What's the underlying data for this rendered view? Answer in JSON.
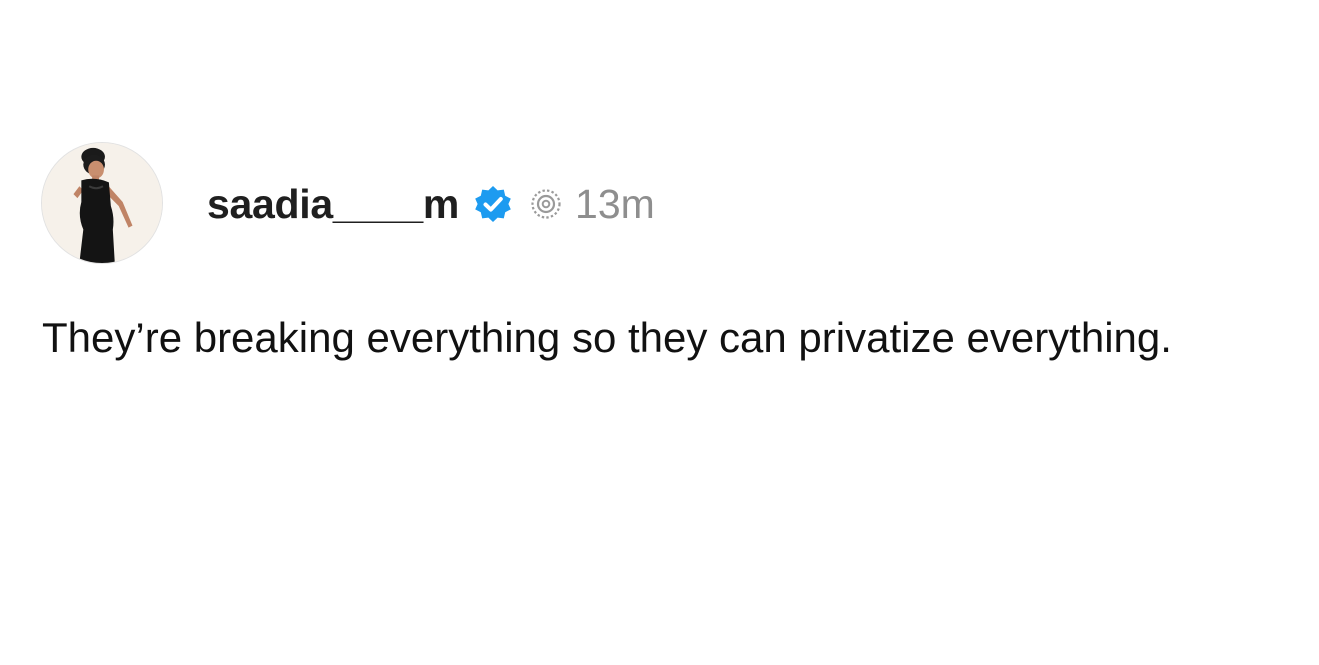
{
  "post": {
    "username": "saadia____m",
    "verified": true,
    "timestamp": "13m",
    "text": "They’re breaking everything so they can privatize everything."
  },
  "icons": {
    "verified": "verified-badge-icon",
    "threads": "threads-logo-icon"
  },
  "colors": {
    "background": "#ffffff",
    "text": "#111111",
    "username": "#1f1f1f",
    "muted": "#8e8e8e",
    "verified_blue": "#1d9bf0"
  }
}
